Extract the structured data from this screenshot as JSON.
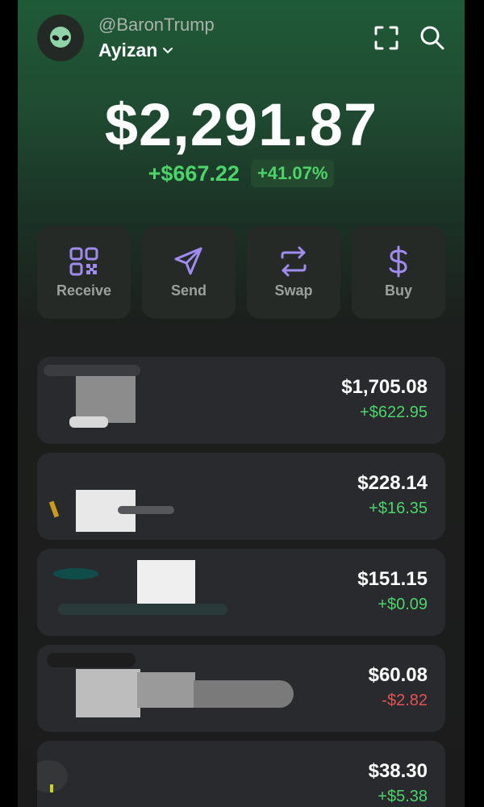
{
  "header": {
    "handle": "@BaronTrump",
    "account_name": "Ayizan"
  },
  "balance": {
    "total": "$2,291.87",
    "change_amount": "+$667.22",
    "change_percent": "+41.07%"
  },
  "actions": [
    {
      "label": "Receive",
      "icon": "qr-code-icon"
    },
    {
      "label": "Send",
      "icon": "send-icon"
    },
    {
      "label": "Swap",
      "icon": "swap-icon"
    },
    {
      "label": "Buy",
      "icon": "dollar-icon"
    }
  ],
  "tokens": [
    {
      "value": "$1,705.08",
      "change": "+$622.95",
      "direction": "up"
    },
    {
      "value": "$228.14",
      "change": "+$16.35",
      "direction": "up"
    },
    {
      "value": "$151.15",
      "change": "+$0.09",
      "direction": "up"
    },
    {
      "value": "$60.08",
      "change": "-$2.82",
      "direction": "down"
    },
    {
      "value": "$38.30",
      "change": "+$5.38",
      "direction": "up"
    }
  ],
  "colors": {
    "accent_purple": "#a08cf0",
    "positive": "#4cd46a",
    "negative": "#e05454"
  }
}
